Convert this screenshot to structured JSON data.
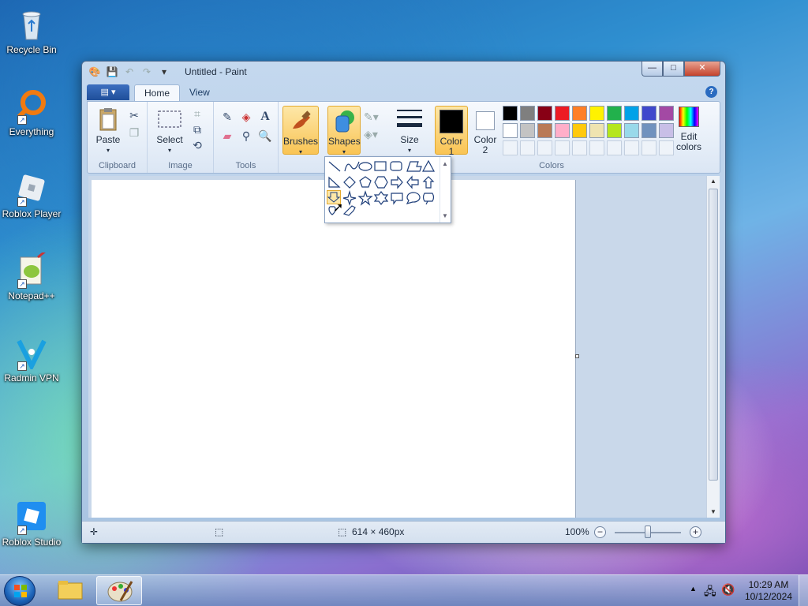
{
  "desktop": {
    "icons": [
      {
        "label": "Recycle Bin"
      },
      {
        "label": "Everything"
      },
      {
        "label": "Roblox Player"
      },
      {
        "label": "Notepad++"
      },
      {
        "label": "Radmin VPN"
      },
      {
        "label": "Roblox Studio"
      }
    ]
  },
  "window": {
    "title": "Untitled - Paint",
    "controls": {
      "minimize": "—",
      "maximize": "□",
      "close": "✕"
    }
  },
  "tabs": {
    "file": "▤ ▾",
    "home": "Home",
    "view": "View",
    "help": "?"
  },
  "ribbon": {
    "clipboard": {
      "label": "Clipboard",
      "paste": "Paste"
    },
    "image": {
      "label": "Image",
      "select": "Select"
    },
    "tools": {
      "label": "Tools"
    },
    "brushes": "Brushes",
    "shapes": "Shapes",
    "size": "Size",
    "colors": {
      "label": "Colors",
      "color1": "Color 1",
      "color1_a": "Color",
      "color1_b": "1",
      "color2_a": "Color",
      "color2_b": "2",
      "edit_a": "Edit",
      "edit_b": "colors",
      "active_color1": "#000000",
      "active_color2": "#ffffff",
      "row1": [
        "#000000",
        "#7f7f7f",
        "#880015",
        "#ed1c24",
        "#ff7f27",
        "#fff200",
        "#22b14c",
        "#00a2e8",
        "#3f48cc",
        "#a349a4"
      ],
      "row2": [
        "#ffffff",
        "#c3c3c3",
        "#b97a57",
        "#ffaec9",
        "#ffc90e",
        "#efe4b0",
        "#b5e61d",
        "#99d9ea",
        "#7092be",
        "#c8bfe7"
      ]
    }
  },
  "statusbar": {
    "canvas_size": "614 × 460px",
    "zoom": "100%"
  },
  "taskbar": {
    "time": "10:29 AM",
    "date": "10/12/2024"
  }
}
